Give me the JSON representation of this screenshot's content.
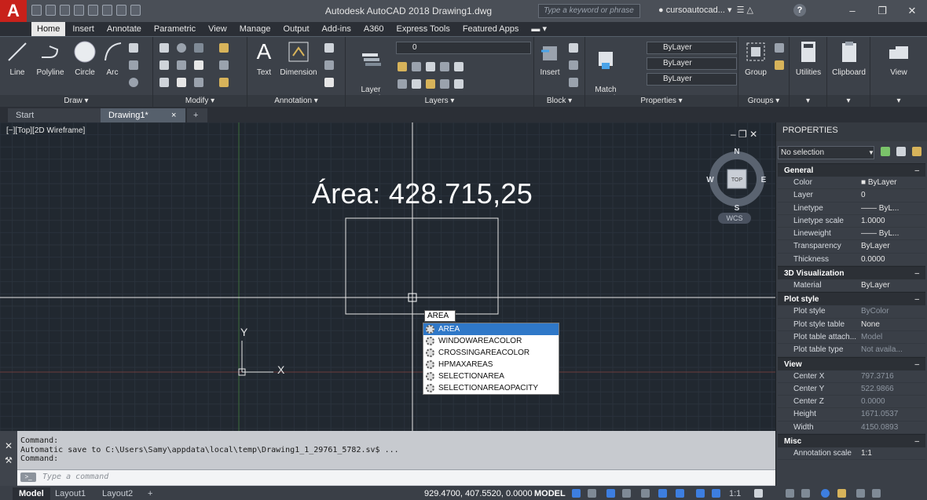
{
  "titlebar": {
    "logo": "A",
    "title": "Autodesk AutoCAD 2018  Drawing1.dwg",
    "search_placeholder": "Type a keyword or phrase",
    "user": "cursoautocad...",
    "help": "?",
    "minimize": "–",
    "restore": "❐",
    "close": "✕"
  },
  "ribbon_tabs": [
    "Home",
    "Insert",
    "Annotate",
    "Parametric",
    "View",
    "Manage",
    "Output",
    "Add-ins",
    "A360",
    "Express Tools",
    "Featured Apps"
  ],
  "ribbon": {
    "draw": {
      "title": "Draw ▾",
      "line": "Line",
      "polyline": "Polyline",
      "circle": "Circle",
      "arc": "Arc"
    },
    "modify": {
      "title": "Modify ▾"
    },
    "annotation": {
      "title": "Annotation ▾",
      "text": "Text",
      "dimension": "Dimension"
    },
    "layers": {
      "title": "Layers ▾",
      "layer_props": "Layer\nProperties",
      "layer_combo": "0"
    },
    "block": {
      "title": "Block ▾",
      "insert": "Insert"
    },
    "properties": {
      "title": "Properties ▾",
      "match": "Match\nProperties",
      "color": "ByLayer",
      "linetype": "ByLayer",
      "lineweight": "ByLayer"
    },
    "groups": {
      "title": "Groups ▾",
      "group": "Group"
    },
    "utilities": {
      "label": "Utilities"
    },
    "clipboard": {
      "label": "Clipboard"
    },
    "view": {
      "label": "View"
    }
  },
  "file_tabs": {
    "start": "Start",
    "drawing": "Drawing1*",
    "close": "×",
    "add": "+"
  },
  "viewport": {
    "label": "[−][Top][2D Wireframe]",
    "area_text": "Área: 428.715,25",
    "controls": "– ❐ ✕",
    "viewcube": {
      "top": "TOP",
      "n": "N",
      "s": "S",
      "e": "E",
      "w": "W"
    },
    "wcs": "WCS",
    "ucs_x": "X",
    "ucs_y": "Y"
  },
  "autocomplete": {
    "typed": "AREA",
    "items": [
      "AREA",
      "WINDOWAREACOLOR",
      "CROSSINGAREACOLOR",
      "HPMAXAREAS",
      "SELECTIONAREA",
      "SELECTIONAREAOPACITY"
    ],
    "selected_index": 0
  },
  "properties": {
    "title": "PROPERTIES",
    "selection": "No selection",
    "sections": [
      {
        "name": "General",
        "rows": [
          {
            "key": "Color",
            "value": "■ ByLayer"
          },
          {
            "key": "Layer",
            "value": "0"
          },
          {
            "key": "Linetype",
            "value": "—— ByL..."
          },
          {
            "key": "Linetype scale",
            "value": "1.0000"
          },
          {
            "key": "Lineweight",
            "value": "—— ByL..."
          },
          {
            "key": "Transparency",
            "value": "ByLayer"
          },
          {
            "key": "Thickness",
            "value": "0.0000"
          }
        ]
      },
      {
        "name": "3D Visualization",
        "rows": [
          {
            "key": "Material",
            "value": "ByLayer"
          }
        ]
      },
      {
        "name": "Plot style",
        "rows": [
          {
            "key": "Plot style",
            "value": "ByColor",
            "dim": true
          },
          {
            "key": "Plot style table",
            "value": "None"
          },
          {
            "key": "Plot table attach...",
            "value": "Model",
            "dim": true
          },
          {
            "key": "Plot table type",
            "value": "Not availa...",
            "dim": true
          }
        ]
      },
      {
        "name": "View",
        "rows": [
          {
            "key": "Center X",
            "value": "797.3716",
            "dim": true
          },
          {
            "key": "Center Y",
            "value": "522.9866",
            "dim": true
          },
          {
            "key": "Center Z",
            "value": "0.0000",
            "dim": true
          },
          {
            "key": "Height",
            "value": "1671.0537",
            "dim": true
          },
          {
            "key": "Width",
            "value": "4150.0893",
            "dim": true
          }
        ]
      },
      {
        "name": "Misc",
        "rows": [
          {
            "key": "Annotation scale",
            "value": "1:1"
          }
        ]
      }
    ]
  },
  "command_line": {
    "history": [
      "Command:",
      "Automatic save to C:\\Users\\Samy\\appdata\\local\\temp\\Drawing1_1_29761_5782.sv$ ...",
      "Command:"
    ],
    "placeholder": "Type a command"
  },
  "statusbar": {
    "layouts": [
      "Model",
      "Layout1",
      "Layout2"
    ],
    "add": "+",
    "coords": "929.4700, 407.5520, 0.0000",
    "model": "MODEL",
    "scale": "1:1"
  },
  "colors": {
    "canvas": "#212830",
    "accent": "#2f78c8",
    "logo": "#c8211b"
  }
}
